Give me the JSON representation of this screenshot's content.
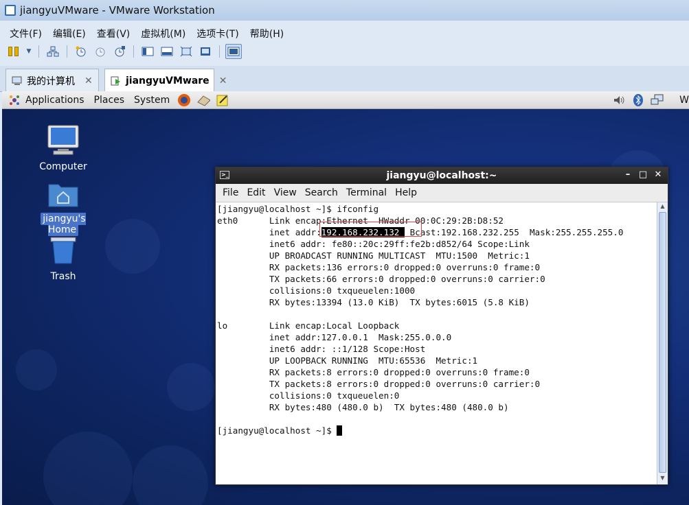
{
  "window": {
    "title": "jiangyuVMware - VMware Workstation"
  },
  "menu": [
    "文件(F)",
    "编辑(E)",
    "查看(V)",
    "虚拟机(M)",
    "选项卡(T)",
    "帮助(H)"
  ],
  "tabs": [
    {
      "label": "我的计算机",
      "close": "✕"
    },
    {
      "label": "jiangyuVMware",
      "close": "✕"
    }
  ],
  "guest_panel": {
    "applications": "Applications",
    "places": "Places",
    "system": "System",
    "clipped": "W"
  },
  "desktop_icons": {
    "computer": "Computer",
    "home": "jiangyu's Home",
    "trash": "Trash"
  },
  "terminal": {
    "title": "jiangyu@localhost:~",
    "menu": [
      "File",
      "Edit",
      "View",
      "Search",
      "Terminal",
      "Help"
    ],
    "lines": {
      "l01": "[jiangyu@localhost ~]$ ifconfig",
      "l02": "eth0      Link encap:Ethernet  HWaddr 00:0C:29:2B:D8:52",
      "l03a": "          inet addr:",
      "l03b": "192.168.232.132 ",
      "l03c": " Bcast:192.168.232.255  Mask:255.255.255.0",
      "l04": "          inet6 addr: fe80::20c:29ff:fe2b:d852/64 Scope:Link",
      "l05": "          UP BROADCAST RUNNING MULTICAST  MTU:1500  Metric:1",
      "l06": "          RX packets:136 errors:0 dropped:0 overruns:0 frame:0",
      "l07": "          TX packets:66 errors:0 dropped:0 overruns:0 carrier:0",
      "l08": "          collisions:0 txqueuelen:1000",
      "l09": "          RX bytes:13394 (13.0 KiB)  TX bytes:6015 (5.8 KiB)",
      "l10": "",
      "l11": "lo        Link encap:Local Loopback",
      "l12": "          inet addr:127.0.0.1  Mask:255.0.0.0",
      "l13": "          inet6 addr: ::1/128 Scope:Host",
      "l14": "          UP LOOPBACK RUNNING  MTU:65536  Metric:1",
      "l15": "          RX packets:8 errors:0 dropped:0 overruns:0 frame:0",
      "l16": "          TX packets:8 errors:0 dropped:0 overruns:0 carrier:0",
      "l17": "          collisions:0 txqueuelen:0",
      "l18": "          RX bytes:480 (480.0 b)  TX bytes:480 (480.0 b)",
      "l19": "",
      "l20": "[jiangyu@localhost ~]$ "
    }
  },
  "colors": {
    "desktop": "#14307a",
    "titlebar": "#c9dbef",
    "selection": "#4a74c9",
    "highlight_box": "#e04040"
  }
}
